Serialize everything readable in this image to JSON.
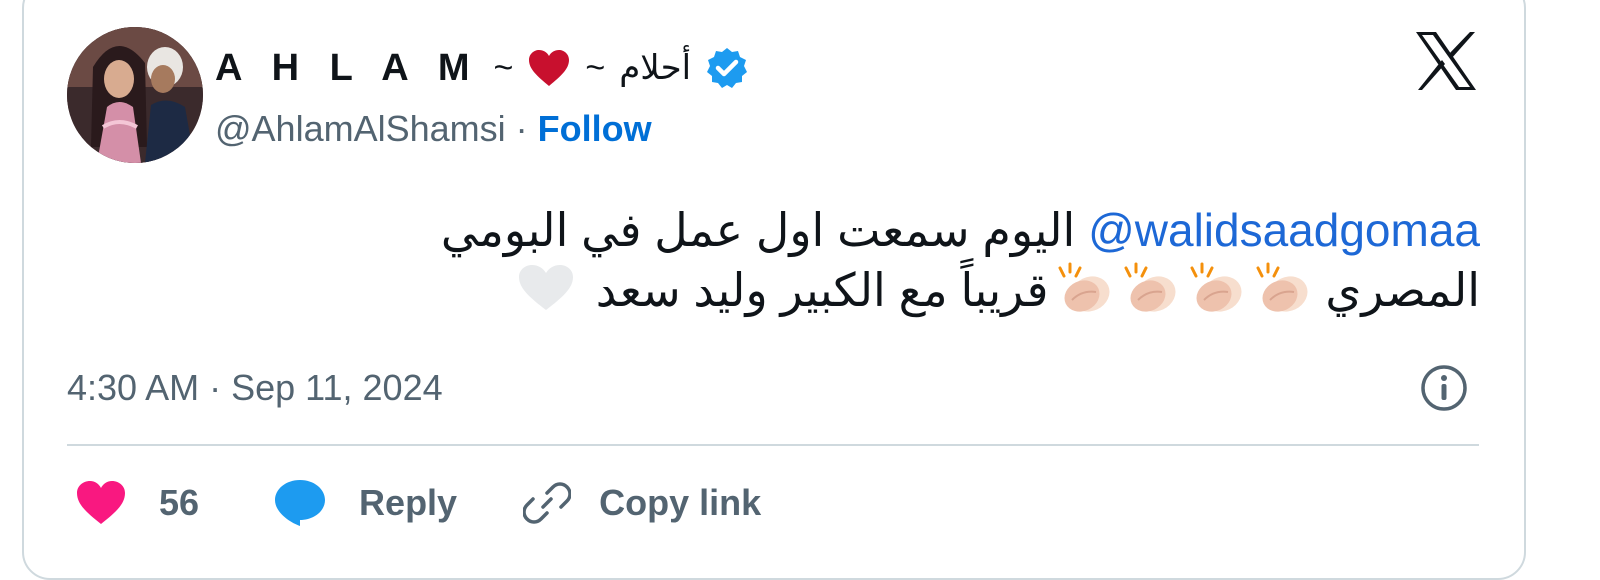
{
  "author": {
    "display_name": "A H L A M",
    "tilde": "~",
    "arabic_name": "أحلام",
    "handle": "@AhlamAlShamsi",
    "separator": "·",
    "follow_label": "Follow",
    "verified": true
  },
  "tweet": {
    "mention": "@walidsaadgomaa",
    "text_line1": " اليوم سمعت اول عمل في البومي",
    "text_line2": "المصري ",
    "text_line3": "قريباً مع الكبير وليد سعد",
    "emoji_clap_count": 4
  },
  "meta": {
    "time": "4:30 AM",
    "separator": "·",
    "date": "Sep 11, 2024"
  },
  "actions": {
    "likes": "56",
    "reply_label": "Reply",
    "copy_label": "Copy link"
  },
  "colors": {
    "link_blue": "#1d68d6",
    "follow_blue": "#006fd6",
    "like_pink": "#f91880",
    "reply_blue": "#1d9bf0",
    "secondary_text": "#536471",
    "border": "#cfd9de"
  },
  "icons": {
    "logo": "x-logo-icon",
    "verified": "verified-badge-icon",
    "heart": "heart-icon",
    "reply": "reply-bubble-icon",
    "link": "link-icon",
    "info": "info-icon",
    "clap": "clapping-hands-icon",
    "white_heart": "white-heart-icon"
  }
}
